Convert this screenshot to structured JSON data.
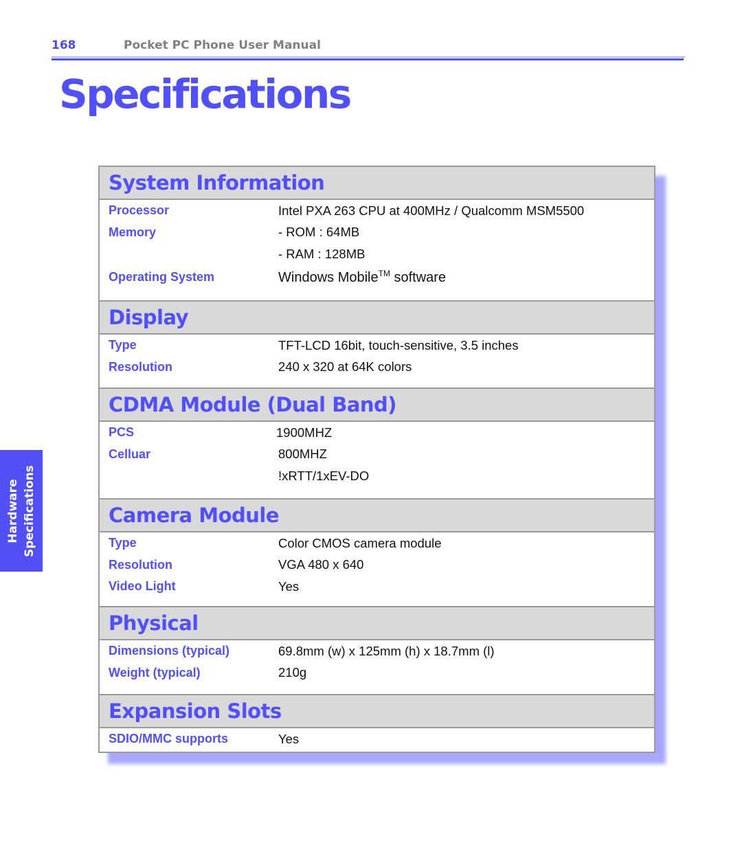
{
  "header": {
    "page_number": "168",
    "manual_title": "Pocket PC Phone User Manual"
  },
  "page_title": "Specifications",
  "side_tab": {
    "line1": "Hardware",
    "line2": "Specifications"
  },
  "colors": {
    "accent": "#5050ff",
    "header_gray": "#808080",
    "section_bg": "#d9d9d9",
    "shadow": "#a6a6ff"
  },
  "sections": [
    {
      "title": "System Information",
      "rows": [
        {
          "label": "Processor",
          "value": "Intel PXA 263 CPU at 400MHz / Qualcomm MSM5500"
        },
        {
          "label": "Memory",
          "value": "- ROM : 64MB"
        },
        {
          "label": "",
          "value": "- RAM : 128MB"
        },
        {
          "label": "Operating System",
          "value": "Windows Mobile",
          "value_sup": "TM",
          "value_suffix": " software"
        }
      ]
    },
    {
      "title": "Display",
      "rows": [
        {
          "label": "Type",
          "value": "TFT-LCD 16bit, touch-sensitive, 3.5 inches"
        },
        {
          "label": "Resolution",
          "value": "240 x 320 at 64K colors"
        }
      ]
    },
    {
      "title": "CDMA Module (Dual Band)",
      "rows": [
        {
          "label": "PCS",
          "value": "1900MHZ"
        },
        {
          "label": "Celluar",
          "value": "800MHZ"
        },
        {
          "label": "",
          "value": "!xRTT/1xEV-DO"
        }
      ]
    },
    {
      "title": "Camera Module",
      "rows": [
        {
          "label": "Type",
          "value": "Color CMOS camera module"
        },
        {
          "label": "Resolution",
          "value": "VGA 480 x 640"
        },
        {
          "label": "Video Light",
          "value": "Yes"
        }
      ]
    },
    {
      "title": "Physical",
      "rows": [
        {
          "label": "Dimensions (typical)",
          "value": "69.8mm (w) x 125mm (h) x 18.7mm (l)"
        },
        {
          "label": "Weight (typical)",
          "value": "210g"
        }
      ]
    },
    {
      "title": "Expansion Slots",
      "rows": [
        {
          "label": "SDIO/MMC supports",
          "value": "Yes"
        }
      ]
    }
  ]
}
